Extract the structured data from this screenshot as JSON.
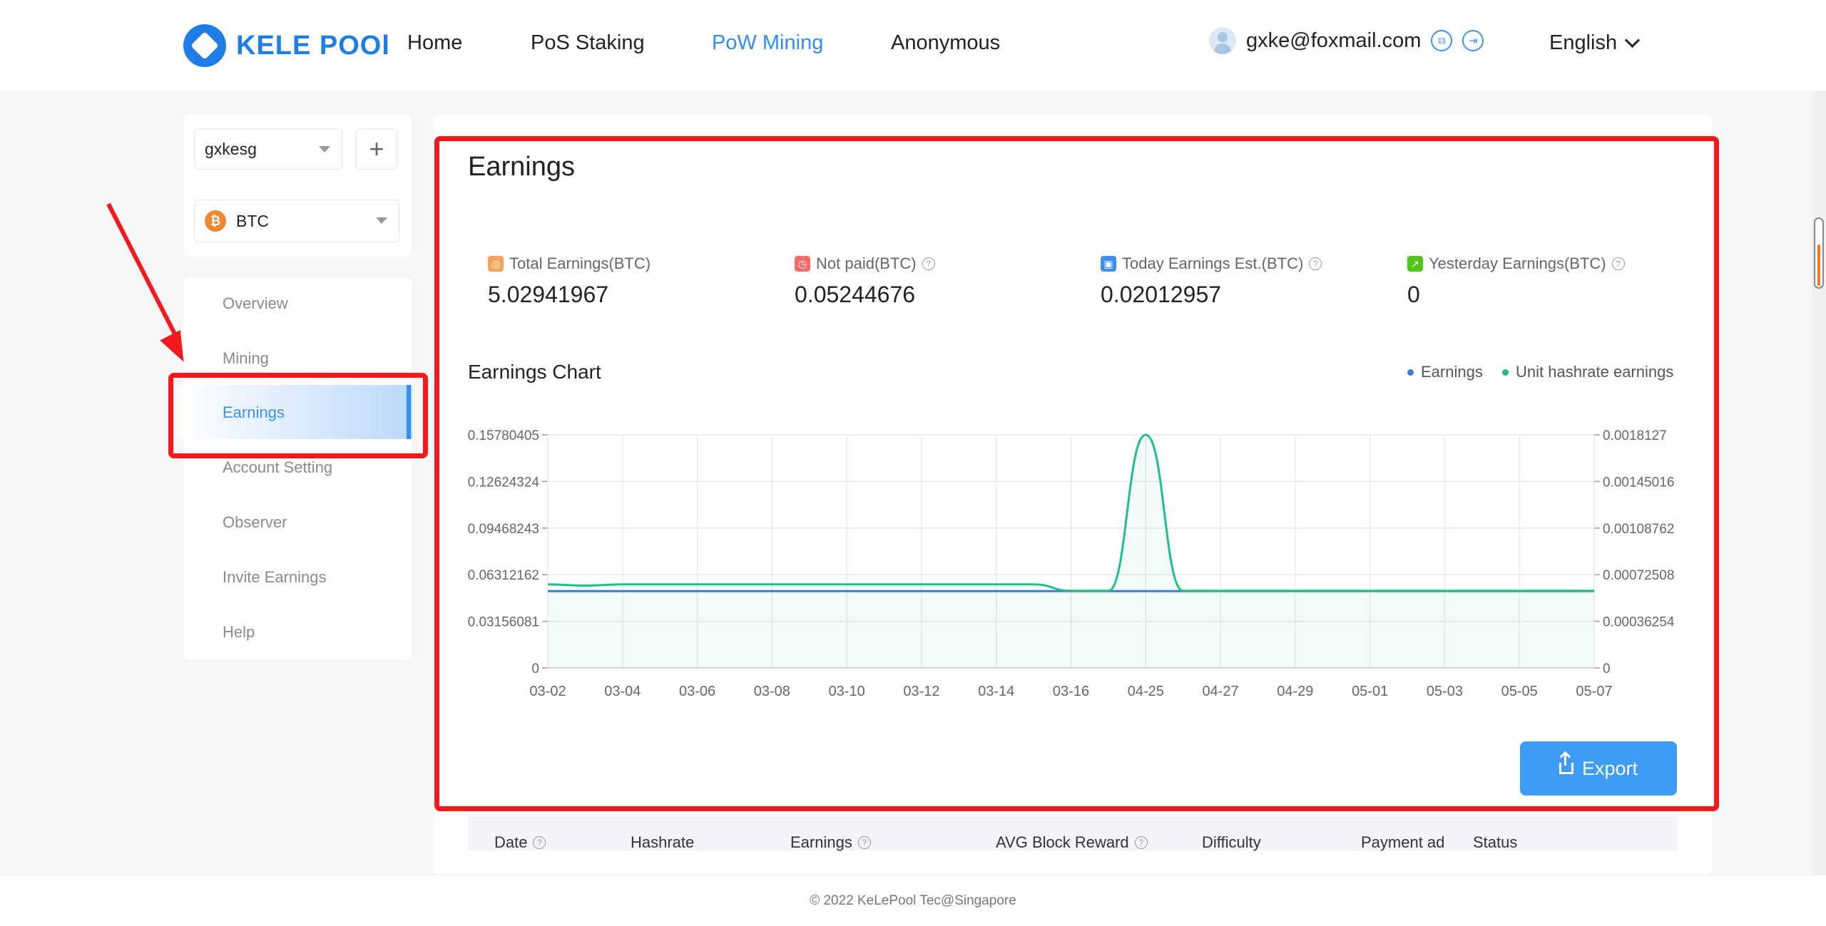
{
  "header": {
    "logo_text": "KELE POOl",
    "nav": [
      "Home",
      "PoS Staking",
      "PoW Mining",
      "Anonymous"
    ],
    "active_nav": "PoW Mining",
    "user_email": "gxke@foxmail.com",
    "language": "English"
  },
  "sidebar": {
    "account_select": "gxkesg",
    "coin_select": "BTC",
    "menu": [
      "Overview",
      "Mining",
      "Earnings",
      "Account Setting",
      "Observer",
      "Invite Earnings",
      "Help"
    ],
    "active_menu": "Earnings"
  },
  "main": {
    "title": "Earnings",
    "cards": [
      {
        "label": "Total Earnings(BTC)",
        "value": "5.02941967",
        "color": "#fdf4ef",
        "icon_color": "#f7a35c",
        "help": false
      },
      {
        "label": "Not paid(BTC)",
        "value": "0.05244676",
        "color": "#fdeeee",
        "icon_color": "#f56c6c",
        "help": true
      },
      {
        "label": "Today Earnings Est.(BTC)",
        "value": "0.02012957",
        "color": "#eef4fd",
        "icon_color": "#3a8ff0",
        "help": true
      },
      {
        "label": "Yesterday Earnings(BTC)",
        "value": "0",
        "color": "#eff7ee",
        "icon_color": "#52c41a",
        "help": true
      }
    ],
    "chart_title": "Earnings Chart",
    "export_label": "Export",
    "table_headers": [
      "Date",
      "Hashrate",
      "Earnings",
      "AVG Block Reward",
      "Difficulty",
      "Payment ad",
      "Status"
    ]
  },
  "chart_data": {
    "type": "line",
    "x": [
      "03-02",
      "03-03",
      "03-04",
      "03-05",
      "03-06",
      "03-07",
      "03-08",
      "03-09",
      "03-10",
      "03-11",
      "03-12",
      "03-13",
      "03-14",
      "03-15",
      "03-16",
      "03-17",
      "04-25",
      "04-26",
      "04-27",
      "04-28",
      "04-29",
      "04-30",
      "05-01",
      "05-02",
      "05-03",
      "05-04",
      "05-05",
      "05-06",
      "05-07"
    ],
    "x_tick_labels": [
      "03-02",
      "03-04",
      "03-06",
      "03-08",
      "03-10",
      "03-12",
      "03-14",
      "03-16",
      "04-25",
      "04-27",
      "04-29",
      "05-01",
      "05-03",
      "05-05",
      "05-07"
    ],
    "y_left_ticks": [
      "0",
      "0.03156081",
      "0.06312162",
      "0.09468243",
      "0.12624324",
      "0.15780405"
    ],
    "y_right_ticks": [
      "0",
      "0.00036254",
      "0.00072508",
      "0.00108762",
      "0.00145016",
      "0.0018127"
    ],
    "ylim_left": [
      0,
      0.15780405
    ],
    "ylim_right": [
      0,
      0.0018127
    ],
    "series": [
      {
        "name": "Earnings",
        "color": "#3a7bd5",
        "axis": "left",
        "values": [
          0.052,
          0.052,
          0.052,
          0.052,
          0.052,
          0.052,
          0.052,
          0.052,
          0.052,
          0.052,
          0.052,
          0.052,
          0.052,
          0.052,
          0.052,
          0.052,
          0.052,
          0.052,
          0.052,
          0.052,
          0.052,
          0.052,
          0.052,
          0.052,
          0.052,
          0.052,
          0.052,
          0.052,
          0.052
        ]
      },
      {
        "name": "Unit hashrate earnings",
        "color": "#1fbf83",
        "axis": "right",
        "values": [
          0.00065,
          0.00064,
          0.00065,
          0.00065,
          0.00065,
          0.00065,
          0.00065,
          0.00065,
          0.00065,
          0.00065,
          0.00065,
          0.00065,
          0.00065,
          0.00065,
          0.0006,
          0.0006,
          0.0018127,
          0.0006,
          0.0006,
          0.0006,
          0.0006,
          0.0006,
          0.0006,
          0.0006,
          0.0006,
          0.0006,
          0.0006,
          0.0006,
          0.0006
        ]
      }
    ],
    "grid": true,
    "legend": "top-right"
  },
  "footer": {
    "copyright": "© 2022 KeLePool Tec@Singapore"
  }
}
